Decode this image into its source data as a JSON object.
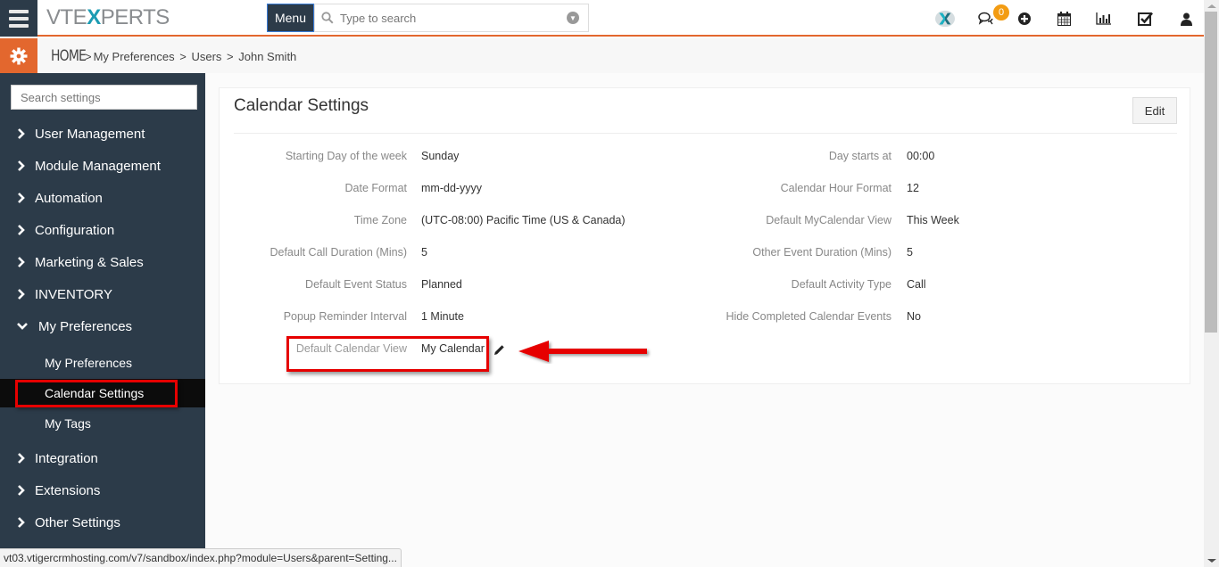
{
  "app": {
    "logo_left": "VTE",
    "logo_x": "X",
    "logo_right": "PERTS",
    "menu_label": "Menu",
    "search_placeholder": "Type to search",
    "notification_count": "0"
  },
  "top_icons": [
    "vtexperts-app-icon",
    "chat-icon",
    "add-icon",
    "calendar-icon",
    "reports-icon",
    "tasks-icon",
    "user-icon"
  ],
  "breadcrumb": {
    "home": "HOME",
    "items": [
      "My Preferences",
      "Users",
      "John Smith"
    ]
  },
  "sidebar": {
    "search_placeholder": "Search settings",
    "items": [
      {
        "label": "User Management",
        "expanded": false
      },
      {
        "label": "Module Management",
        "expanded": false
      },
      {
        "label": "Automation",
        "expanded": false
      },
      {
        "label": "Configuration",
        "expanded": false
      },
      {
        "label": "Marketing & Sales",
        "expanded": false
      },
      {
        "label": "INVENTORY",
        "expanded": false
      },
      {
        "label": "My Preferences",
        "expanded": true
      },
      {
        "label": "Integration",
        "expanded": false
      },
      {
        "label": "Extensions",
        "expanded": false
      },
      {
        "label": "Other Settings",
        "expanded": false
      }
    ],
    "sub_items": [
      {
        "label": "My Preferences",
        "active": false
      },
      {
        "label": "Calendar Settings",
        "active": true
      },
      {
        "label": "My Tags",
        "active": false
      }
    ]
  },
  "panel": {
    "title": "Calendar Settings",
    "edit_label": "Edit",
    "left_fields": [
      {
        "label": "Starting Day of the week",
        "value": "Sunday"
      },
      {
        "label": "Date Format",
        "value": "mm-dd-yyyy"
      },
      {
        "label": "Time Zone",
        "value": "(UTC-08:00) Pacific Time (US & Canada)"
      },
      {
        "label": "Default Call Duration (Mins)",
        "value": "5"
      },
      {
        "label": "Default Event Status",
        "value": "Planned"
      },
      {
        "label": "Popup Reminder Interval",
        "value": "1 Minute"
      },
      {
        "label": "Default Calendar View",
        "value": "My Calendar"
      }
    ],
    "right_fields": [
      {
        "label": "Day starts at",
        "value": "00:00"
      },
      {
        "label": "Calendar Hour Format",
        "value": "12"
      },
      {
        "label": "Default MyCalendar View",
        "value": "This Week"
      },
      {
        "label": "Other Event Duration (Mins)",
        "value": "5"
      },
      {
        "label": "Default Activity Type",
        "value": "Call"
      },
      {
        "label": "Hide Completed Calendar Events",
        "value": "No"
      }
    ]
  },
  "colors": {
    "accent": "#e3672e",
    "sidebar_bg": "#2c3b49",
    "annotation_red": "#e60000",
    "badge": "#f39c12"
  },
  "status_url": "vt03.vtigercrmhosting.com/v7/sandbox/index.php?module=Users&parent=Setting..."
}
